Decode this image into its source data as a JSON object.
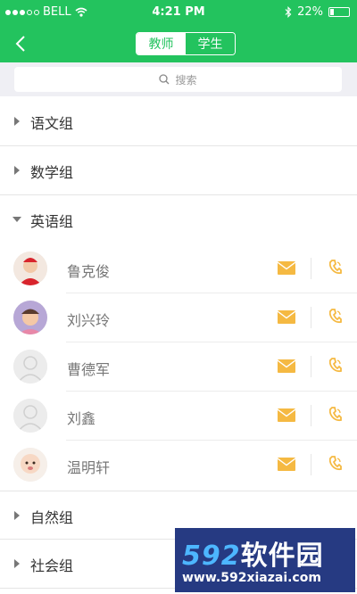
{
  "status_bar": {
    "carrier": "BELL",
    "time": "4:21 PM",
    "battery": "22%",
    "battery_level": 0.22
  },
  "nav": {
    "tab_teacher": "教师",
    "tab_student": "学生",
    "active_tab": "teacher"
  },
  "search": {
    "placeholder": "搜索"
  },
  "groups": [
    {
      "name": "语文组",
      "expanded": false
    },
    {
      "name": "数学组",
      "expanded": false
    },
    {
      "name": "英语组",
      "expanded": true
    },
    {
      "name": "自然组",
      "expanded": false
    },
    {
      "name": "社会组",
      "expanded": false
    }
  ],
  "members": [
    {
      "name": "鲁克俊"
    },
    {
      "name": "刘兴玲"
    },
    {
      "name": "曹德军"
    },
    {
      "name": "刘鑫"
    },
    {
      "name": "温明轩"
    }
  ],
  "colors": {
    "accent": "#23c35e",
    "action_icon": "#f5b942",
    "separator": "#e5e5e5",
    "search_bg": "#efeff4"
  },
  "watermark": {
    "brand_number": "592",
    "brand_text": "软件园",
    "url": "www.592xiazai.com"
  }
}
